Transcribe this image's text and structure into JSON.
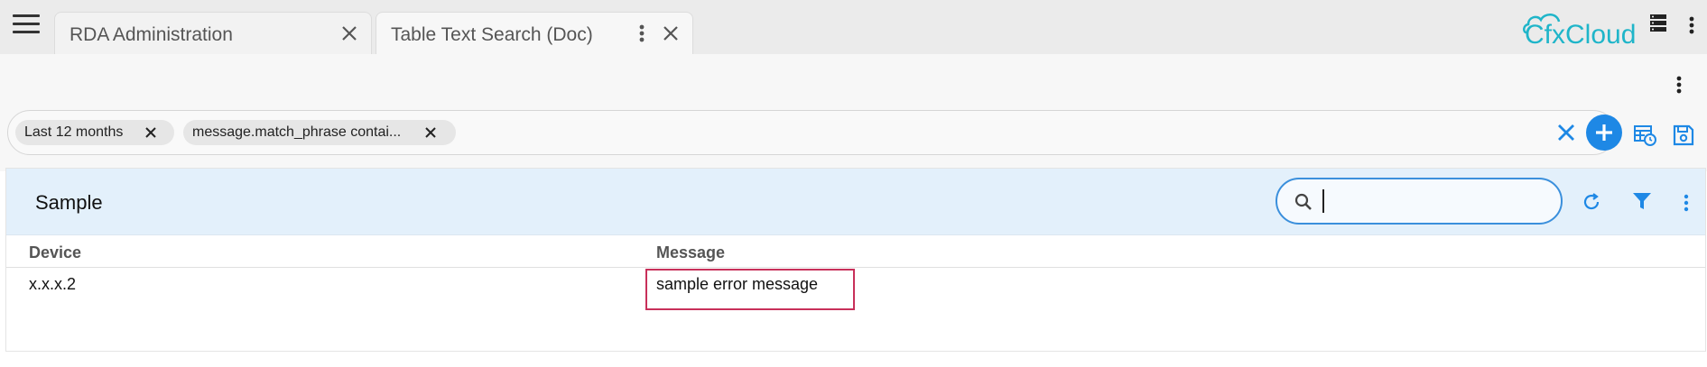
{
  "tabs": [
    {
      "label": "RDA Administration",
      "active": false
    },
    {
      "label": "Table Text Search (Doc)",
      "active": true
    }
  ],
  "brand": {
    "name": "CfxCloud",
    "color": "#1fb5c9"
  },
  "filters": {
    "chips": [
      {
        "label": "Last 12 months"
      },
      {
        "label": "message.match_phrase contai..."
      }
    ]
  },
  "panel": {
    "title": "Sample",
    "search": {
      "value": "",
      "placeholder": ""
    },
    "columns": [
      "Device",
      "Message"
    ],
    "rows": [
      {
        "device": "x.x.x.2",
        "message": "sample error message"
      }
    ]
  },
  "colors": {
    "accent": "#1e88e5",
    "highlight": "#c8305a",
    "panel_header_bg": "#e3f0fb"
  },
  "icons": {
    "menu": "hamburger-menu-icon",
    "close": "close-icon",
    "more": "more-vertical-icon",
    "server": "server-icon",
    "clear": "clear-icon",
    "add": "add-icon",
    "table_clock": "table-schedule-icon",
    "save": "save-icon",
    "search": "search-icon",
    "refresh": "refresh-icon",
    "filter": "filter-icon"
  }
}
